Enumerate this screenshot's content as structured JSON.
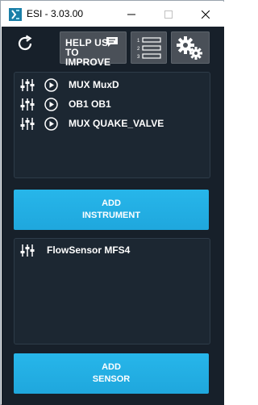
{
  "window": {
    "title": "ESI - 3.03.00"
  },
  "toolbar": {
    "help_line1": "HELP US",
    "help_line2": "TO IMPROVE",
    "list_numbers": [
      "1",
      "2",
      "3"
    ]
  },
  "instruments": [
    {
      "label": "MUX MuxD"
    },
    {
      "label": "OB1 OB1"
    },
    {
      "label": "MUX QUAKE_VALVE"
    }
  ],
  "add_instrument_button": {
    "line1": "ADD",
    "line2": "INSTRUMENT"
  },
  "sensors": [
    {
      "label": "FlowSensor MFS4"
    }
  ],
  "add_sensor_button": {
    "line1": "ADD",
    "line2": "SENSOR"
  },
  "colors": {
    "background": "#17202a",
    "panel": "#1c2732",
    "accent": "#27b6ea",
    "toolbar_button": "#4a5058"
  },
  "icons": {
    "app": "app-logo-icon",
    "refresh": "refresh-icon",
    "help_bubble": "chat-bubble-icon",
    "list": "numbered-list-icon",
    "settings": "gears-icon",
    "instrument_settings": "sliders-icon",
    "instrument_play": "play-icon"
  }
}
